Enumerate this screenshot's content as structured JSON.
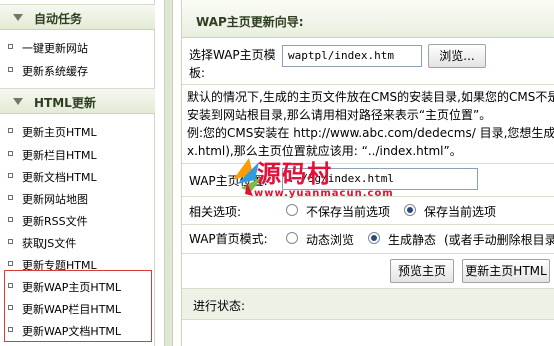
{
  "sidebar": {
    "sections": [
      {
        "title": "自动任务",
        "items": [
          "一键更新网站",
          "更新系统缓存"
        ]
      },
      {
        "title": "HTML更新",
        "items": [
          "更新主页HTML",
          "更新栏目HTML",
          "更新文档HTML",
          "更新网站地图",
          "更新RSS文件",
          "获取JS文件",
          "更新专题HTML",
          "更新WAP主页HTML",
          "更新WAP栏目HTML",
          "更新WAP文档HTML"
        ]
      }
    ]
  },
  "main": {
    "title": "WAP主页更新向导:",
    "template": {
      "label_line1": "选择WAP主页模",
      "label_line2": "板:",
      "value": "waptpl/index.htm",
      "browse_label": "浏览..."
    },
    "help": {
      "line1": "默认的情况下,生成的主页文件放在CMS的安装目录,如果您的CMS不是",
      "line2": "安装到网站根目录,那么请用相对路径来表示“主页位置”。",
      "line3": "例:您的CMS安装在 http://www.abc.com/dedecms/ 目录,您想生成的",
      "line4": "x.html),那么主页位置就应该用: “../index.html”。"
    },
    "location": {
      "label": "WAP主页位置:",
      "value": "../3g/index.html"
    },
    "options": {
      "label": "相关选项:",
      "choices": [
        "不保存当前选项",
        "保存当前选项"
      ],
      "selected_index": 1
    },
    "mode": {
      "label": "WAP首页模式:",
      "choices": [
        "动态浏览",
        "生成静态"
      ],
      "note": "(或者手动删除根目录",
      "selected_index": 1
    },
    "buttons": {
      "preview": "预览主页",
      "update": "更新主页HTML"
    },
    "status": {
      "label": "进行状态:"
    }
  },
  "watermark": {
    "brand": "源码村",
    "url": "www.yuanmacun.com"
  },
  "colors": {
    "highlight_border": "#d93a3a",
    "header_text": "#2f3f22",
    "watermark": "#e3103a"
  }
}
